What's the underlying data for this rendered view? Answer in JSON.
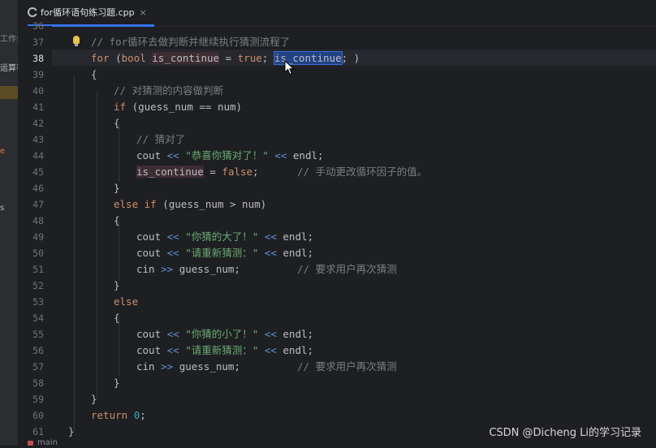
{
  "sidebar": {
    "items": [
      "工作台",
      "运算符",
      "e",
      "s"
    ]
  },
  "tab": {
    "filename": "for循环语句练习题.cpp",
    "close": "×",
    "icon": "cpp-file-icon"
  },
  "editor": {
    "current_line": "38",
    "lines": [
      {
        "n": "36"
      },
      {
        "n": "37"
      },
      {
        "n": "38"
      },
      {
        "n": "39"
      },
      {
        "n": "40"
      },
      {
        "n": "41"
      },
      {
        "n": "42"
      },
      {
        "n": "43"
      },
      {
        "n": "44"
      },
      {
        "n": "45"
      },
      {
        "n": "46"
      },
      {
        "n": "47"
      },
      {
        "n": "48"
      },
      {
        "n": "49"
      },
      {
        "n": "50"
      },
      {
        "n": "51"
      },
      {
        "n": "52"
      },
      {
        "n": "53"
      },
      {
        "n": "54"
      },
      {
        "n": "55"
      },
      {
        "n": "56"
      },
      {
        "n": "57"
      },
      {
        "n": "58"
      },
      {
        "n": "59"
      },
      {
        "n": "60"
      },
      {
        "n": "61"
      }
    ],
    "code": {
      "l37": "// for循环去做判断并继续执行猜测流程了",
      "l38_for": "for",
      "l38_open": " (",
      "l38_bool": "bool",
      "l38_var": "is_continue",
      "l38_eq": " = ",
      "l38_true": "true",
      "l38_semi": "; ",
      "l38_sel": "is_continue",
      "l38_close": "; )",
      "l39": "{",
      "l40": "// 对猜测的内容做判断",
      "l41_if": "if",
      "l41_rest": " (guess_num == num)",
      "l42": "{",
      "l43": "// 猜对了",
      "l44_cout": "cout ",
      "l44_op": "<<",
      "l44_str": " \"恭喜你猜对了！\" ",
      "l44_op2": "<<",
      "l44_end": " endl;",
      "l45_var": "is_continue",
      "l45_eq": " = ",
      "l45_false": "false",
      "l45_semi": ";",
      "l45_cm": "// 手动更改循环因子的值。",
      "l46": "}",
      "l47_kw": "else if",
      "l47_rest": " (guess_num > num)",
      "l48": "{",
      "l49_cout": "cout ",
      "l49_op": "<<",
      "l49_str": " \"你猜的大了！\" ",
      "l49_op2": "<<",
      "l49_end": " endl;",
      "l50_cout": "cout ",
      "l50_op": "<<",
      "l50_str": " \"请重新猜测：\" ",
      "l50_op2": "<<",
      "l50_end": " endl;",
      "l51_cin": "cin ",
      "l51_op": ">>",
      "l51_rest": " guess_num;",
      "l51_cm": "// 要求用户再次猜测",
      "l52": "}",
      "l53": "else",
      "l54": "{",
      "l55_cout": "cout ",
      "l55_op": "<<",
      "l55_str": " \"你猜的小了！\" ",
      "l55_op2": "<<",
      "l55_end": " endl;",
      "l56_cout": "cout ",
      "l56_op": "<<",
      "l56_str": " \"请重新猜测：\" ",
      "l56_op2": "<<",
      "l56_end": " endl;",
      "l57_cin": "cin ",
      "l57_op": ">>",
      "l57_rest": " guess_num;",
      "l57_cm": "// 要求用户再次猜测",
      "l58": "}",
      "l59": "}",
      "l60_kw": "return",
      "l60_num": "0",
      "l60_semi": ";",
      "l61": "}"
    }
  },
  "statusbar": {
    "branch": "main"
  },
  "watermark": "CSDN @Dicheng Li的学习记录",
  "colors": {
    "background": "#1e1f22",
    "keyword": "#cf8e6d",
    "string": "#6aab73",
    "comment": "#7a7e85",
    "number": "#2aacb8",
    "selection": "#214283",
    "tab_accent": "#3574f0"
  }
}
